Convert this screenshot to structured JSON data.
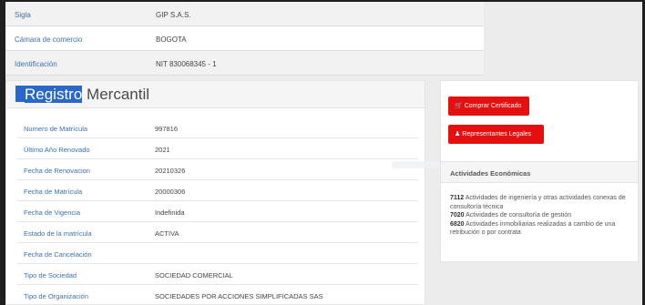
{
  "header_info": [
    {
      "label": "Sigla",
      "value": "GIP S.A.S."
    },
    {
      "label": "Cámara de comercio",
      "value": "BOGOTA"
    },
    {
      "label": "Identificación",
      "value": "NIT 830068345 - 1"
    }
  ],
  "registro": {
    "title_highlight": "Registro",
    "title_rest": "Mercantil",
    "rows": [
      {
        "label": "Numero de Matrícula",
        "value": "997816"
      },
      {
        "label": "Último Año Renovado",
        "value": "2021"
      },
      {
        "label": "Fecha de Renovacion",
        "value": "20210326"
      },
      {
        "label": "Fecha de Matrícula",
        "value": "20000306"
      },
      {
        "label": "Fecha de Vigencia",
        "value": "Indefinida"
      },
      {
        "label": "Estado de la matrícula",
        "value": "ACTIVA"
      },
      {
        "label": "Fecha de Cancelación",
        "value": ""
      },
      {
        "label": "Tipo de Sociedad",
        "value": "SOCIEDAD COMERCIAL"
      },
      {
        "label": "Tipo de Organización",
        "value": "SOCIEDADES POR ACCIONES SIMPLIFICADAS SAS"
      }
    ]
  },
  "actions": {
    "comprar_certificado": "Comprar Certificado",
    "representantes_legales": "Representantes Legales"
  },
  "actividades": {
    "title": "Actividades Económicas",
    "items": [
      {
        "code": "7112",
        "text": " Actividades de ingeniería y otras actividades conexas de consultoría técnica"
      },
      {
        "code": "7020",
        "text": " Actividades de consultoría de gestión"
      },
      {
        "code": "6820",
        "text": " Actividades inmobiliarias realizadas a cambio de una retribución o por contrata"
      }
    ]
  },
  "colors": {
    "label_blue": "#3d6fb1",
    "button_red": "#e60f0f",
    "highlight_blue": "#2b67c6"
  },
  "icons": {
    "cart": "cart-icon",
    "person": "person-icon"
  }
}
